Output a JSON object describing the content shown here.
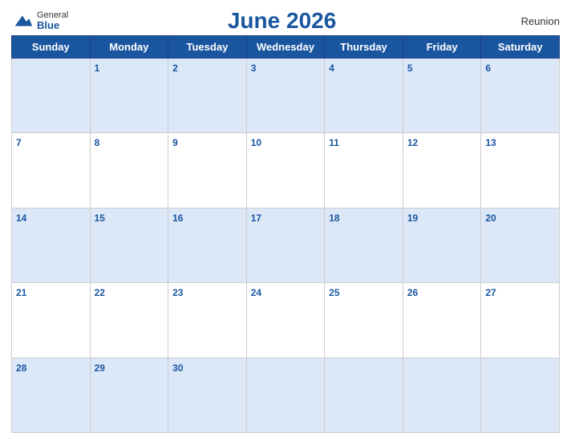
{
  "logo": {
    "general": "General",
    "blue": "Blue"
  },
  "title": "June 2026",
  "region": "Reunion",
  "days_of_week": [
    "Sunday",
    "Monday",
    "Tuesday",
    "Wednesday",
    "Thursday",
    "Friday",
    "Saturday"
  ],
  "weeks": [
    [
      null,
      1,
      2,
      3,
      4,
      5,
      6
    ],
    [
      7,
      8,
      9,
      10,
      11,
      12,
      13
    ],
    [
      14,
      15,
      16,
      17,
      18,
      19,
      20
    ],
    [
      21,
      22,
      23,
      24,
      25,
      26,
      27
    ],
    [
      28,
      29,
      30,
      null,
      null,
      null,
      null
    ]
  ]
}
